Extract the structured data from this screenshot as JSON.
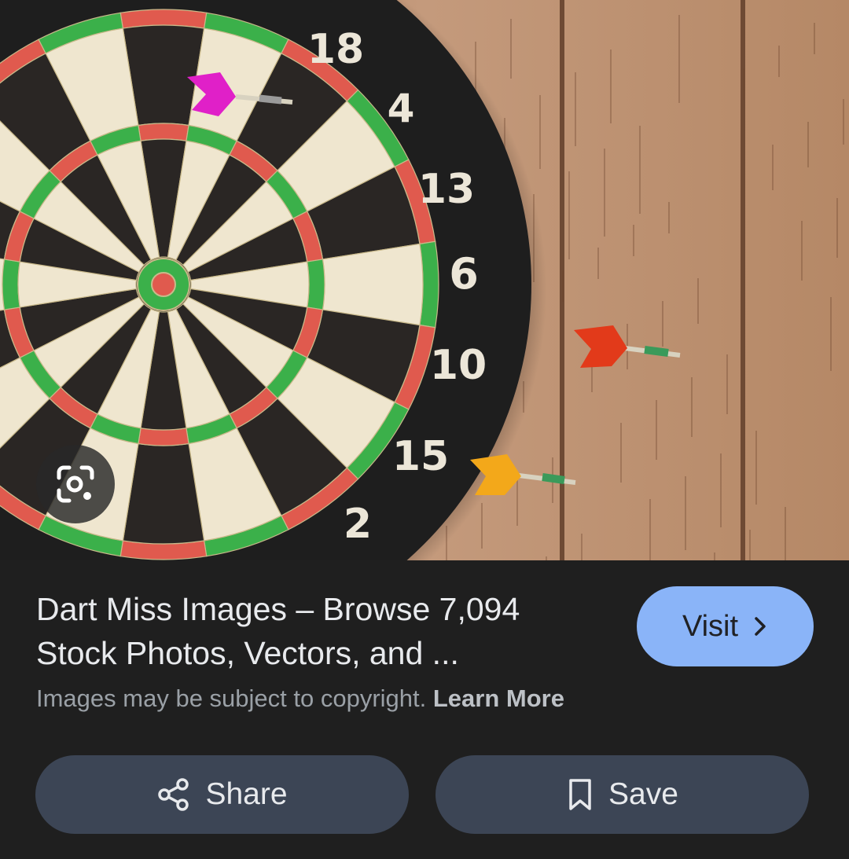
{
  "result": {
    "title": "Dart Miss Images – Browse 7,094 Stock Photos, Vectors, and ...",
    "copyright_text": "Images may be subject to copyright.",
    "learn_more_label": "Learn More"
  },
  "buttons": {
    "visit_label": "Visit",
    "share_label": "Share",
    "save_label": "Save"
  },
  "image": {
    "board_numbers": [
      "18",
      "4",
      "13",
      "6",
      "10",
      "15",
      "2"
    ],
    "icons": {
      "lens": "google-lens-icon",
      "visit": "chevron-right-icon",
      "share": "share-icon",
      "save": "bookmark-icon"
    }
  },
  "colors": {
    "background": "#1f1f1f",
    "visit_button": "#8ab4f8",
    "action_button": "#3c4555",
    "text_primary": "#e8eaed",
    "text_secondary": "#9aa0a6"
  }
}
